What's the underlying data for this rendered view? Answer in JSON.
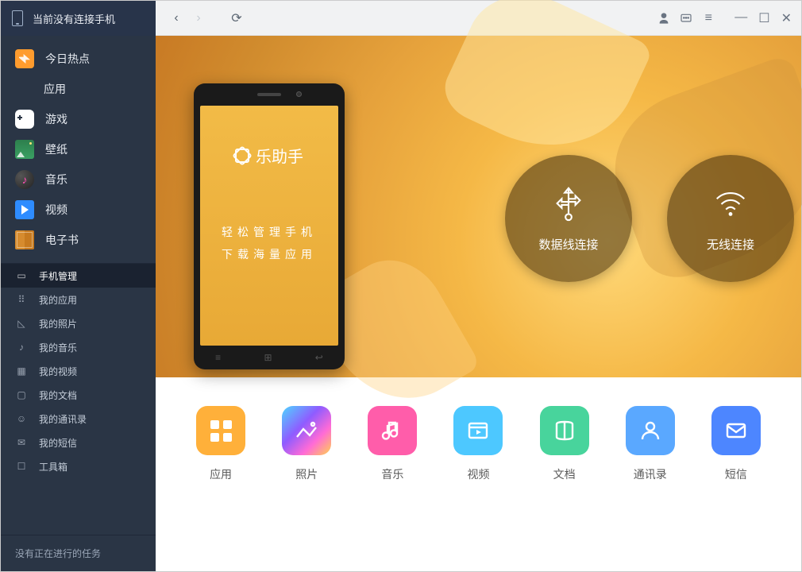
{
  "sidebar": {
    "header": "当前没有连接手机",
    "nav": [
      {
        "label": "今日热点"
      },
      {
        "label": "应用"
      },
      {
        "label": "游戏"
      },
      {
        "label": "壁纸"
      },
      {
        "label": "音乐"
      },
      {
        "label": "视频"
      },
      {
        "label": "电子书"
      }
    ],
    "sub": [
      {
        "label": "手机管理",
        "active": true
      },
      {
        "label": "我的应用"
      },
      {
        "label": "我的照片"
      },
      {
        "label": "我的音乐"
      },
      {
        "label": "我的视频"
      },
      {
        "label": "我的文档"
      },
      {
        "label": "我的通讯录"
      },
      {
        "label": "我的短信"
      },
      {
        "label": "工具箱"
      }
    ],
    "footer": "没有正在进行的任务"
  },
  "hero": {
    "phone_title": "乐助手",
    "slogan_line1": "轻松管理手机",
    "slogan_line2": "下载海量应用",
    "usb_label": "数据线连接",
    "wifi_label": "无线连接"
  },
  "tiles": [
    {
      "label": "应用"
    },
    {
      "label": "照片"
    },
    {
      "label": "音乐"
    },
    {
      "label": "视频"
    },
    {
      "label": "文档"
    },
    {
      "label": "通讯录"
    },
    {
      "label": "短信"
    }
  ]
}
